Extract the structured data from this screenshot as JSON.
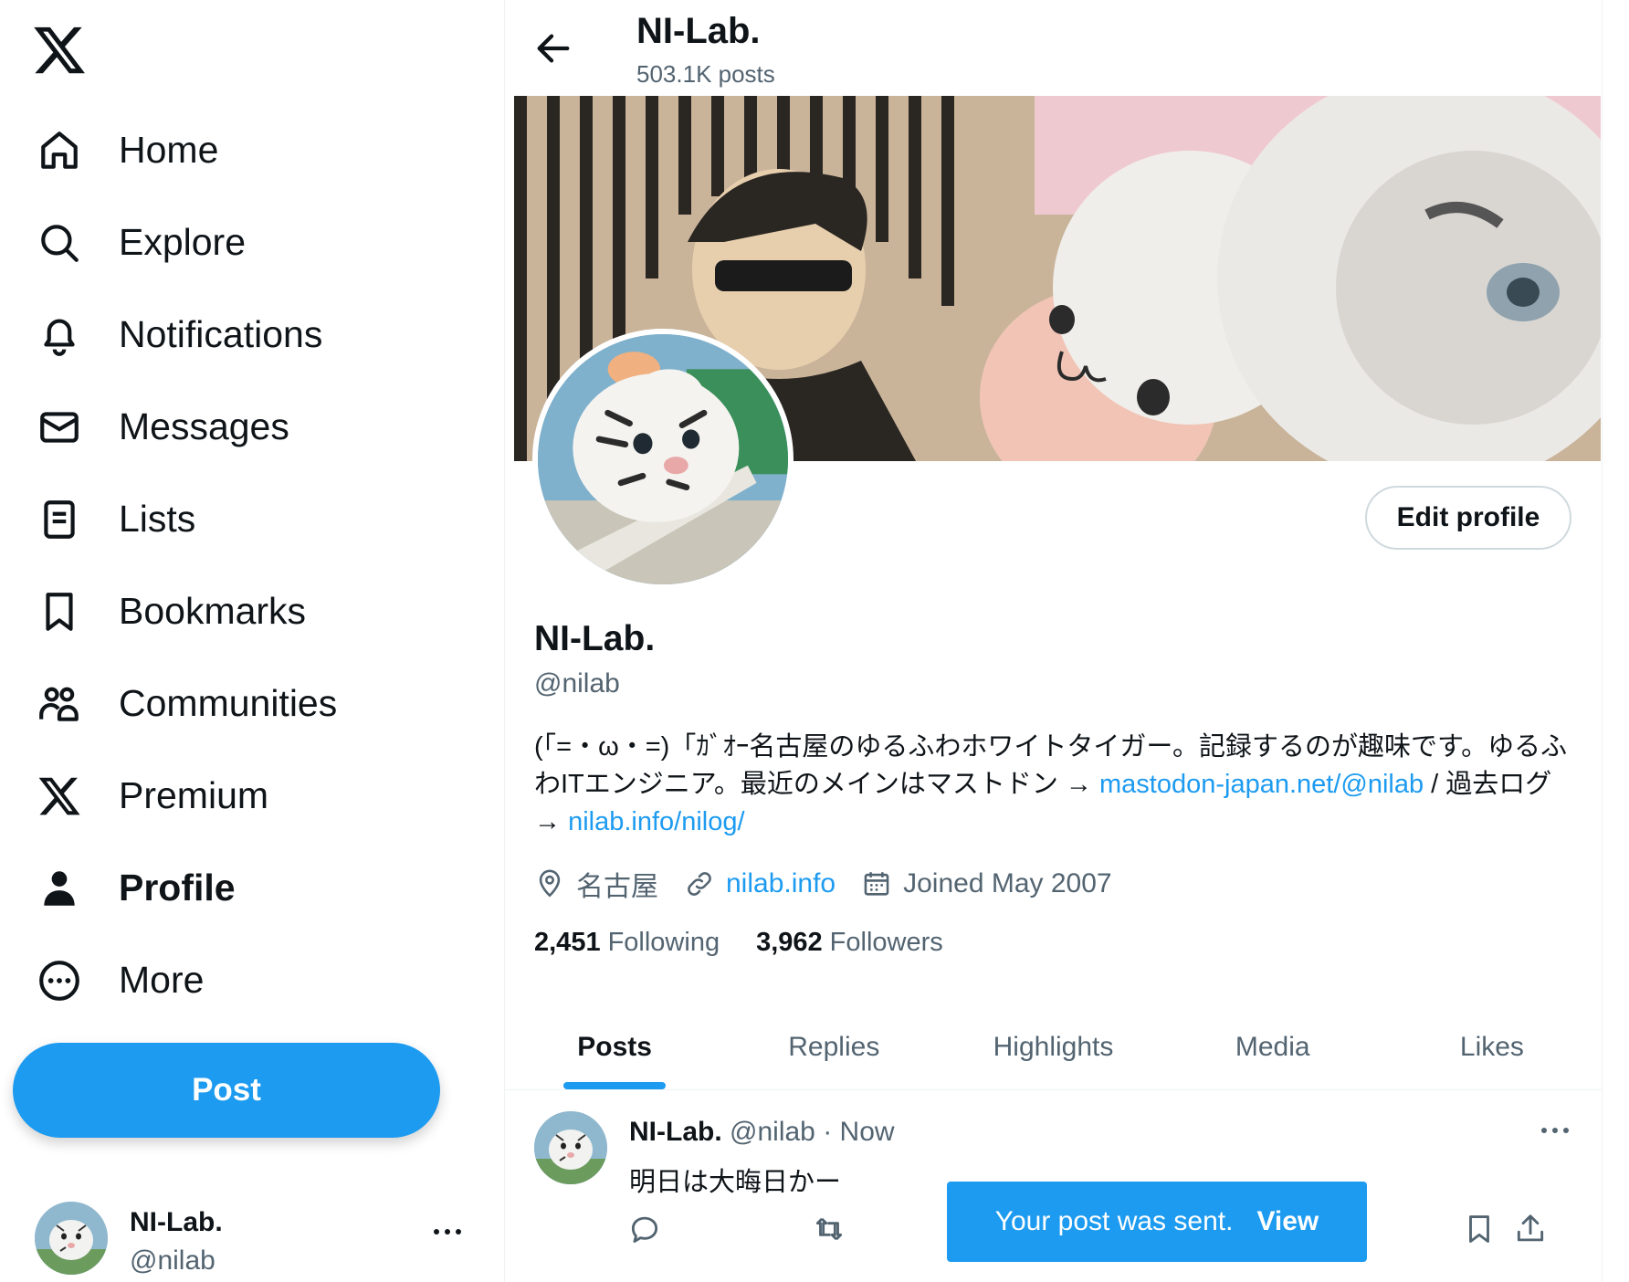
{
  "nav": {
    "items": [
      {
        "label": "Home",
        "icon": "home-icon"
      },
      {
        "label": "Explore",
        "icon": "search-icon"
      },
      {
        "label": "Notifications",
        "icon": "bell-icon"
      },
      {
        "label": "Messages",
        "icon": "envelope-icon"
      },
      {
        "label": "Lists",
        "icon": "list-icon"
      },
      {
        "label": "Bookmarks",
        "icon": "bookmark-icon"
      },
      {
        "label": "Communities",
        "icon": "people-icon"
      },
      {
        "label": "Premium",
        "icon": "x-logo-icon"
      },
      {
        "label": "Profile",
        "icon": "person-icon",
        "active": true
      },
      {
        "label": "More",
        "icon": "more-circle-icon"
      }
    ],
    "post_label": "Post"
  },
  "account": {
    "name": "NI-Lab.",
    "handle": "@nilab"
  },
  "header": {
    "title": "NI-Lab.",
    "post_count": "503.1K posts"
  },
  "profile": {
    "edit_label": "Edit profile",
    "name": "NI-Lab.",
    "handle": "@nilab",
    "bio_part1": "(「=・ω・=)「ｶﾞｵｰ名古屋のゆるふわホワイトタイガー。記録するのが趣味です。ゆるふわITエンジニア。最近のメインはマストドン → ",
    "bio_link1": "mastodon-japan.net/@nilab",
    "bio_part2": " / 過去ログ → ",
    "bio_link2": "nilab.info/nilog/",
    "location": "名古屋",
    "website": "nilab.info",
    "joined": "Joined May 2007",
    "following_count": "2,451",
    "following_label": "Following",
    "followers_count": "3,962",
    "followers_label": "Followers"
  },
  "tabs": [
    {
      "label": "Posts",
      "active": true
    },
    {
      "label": "Replies"
    },
    {
      "label": "Highlights"
    },
    {
      "label": "Media"
    },
    {
      "label": "Likes"
    }
  ],
  "post": {
    "name": "NI-Lab.",
    "handle": "@nilab",
    "separator": "·",
    "time": "Now",
    "text": "明日は大晦日かー"
  },
  "toast": {
    "message": "Your post was sent.",
    "action": "View"
  },
  "colors": {
    "accent": "#1d9bf0",
    "text": "#0f1419",
    "secondary": "#536471",
    "border": "#eff3f4"
  }
}
